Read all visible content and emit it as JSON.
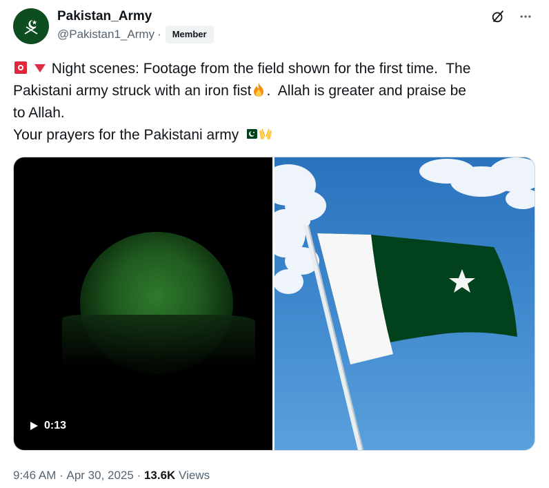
{
  "author": {
    "display_name": "Pakistan_Army",
    "handle": "@Pakistan1_Army",
    "separator": "·",
    "badge": "Member"
  },
  "icons": {
    "avatar": "pakistan-army-crest-icon",
    "grok": "grok-icon",
    "more": "more-options-icon",
    "siren": "rotating-light-icon",
    "triangle": "red-triangle-down-icon",
    "fire": "fire-icon",
    "flag": "pakistan-flag-icon",
    "hands": "palms-up-together-icon",
    "play": "play-icon"
  },
  "tweet": {
    "line1_text": "Night scenes: Footage from the field shown for the first time.  The",
    "line2_text": "Pakistani army struck with an iron fist",
    "line2_after": ".  Allah is greater and praise be",
    "line3_text": "to Allah.",
    "line4_text": "Your prayers for the Pakistani army"
  },
  "media": {
    "video_duration": "0:13"
  },
  "meta": {
    "time": "9:46 AM",
    "sep1": " · ",
    "date": "Apr 30, 2025",
    "sep2": " · ",
    "views_count": "13.6K",
    "views_label": " Views"
  },
  "colors": {
    "text": "#0f1419",
    "secondary": "#536471",
    "avatar_bg": "#0d4d1f",
    "flag_green": "#01411c",
    "siren_red": "#e0283b"
  }
}
